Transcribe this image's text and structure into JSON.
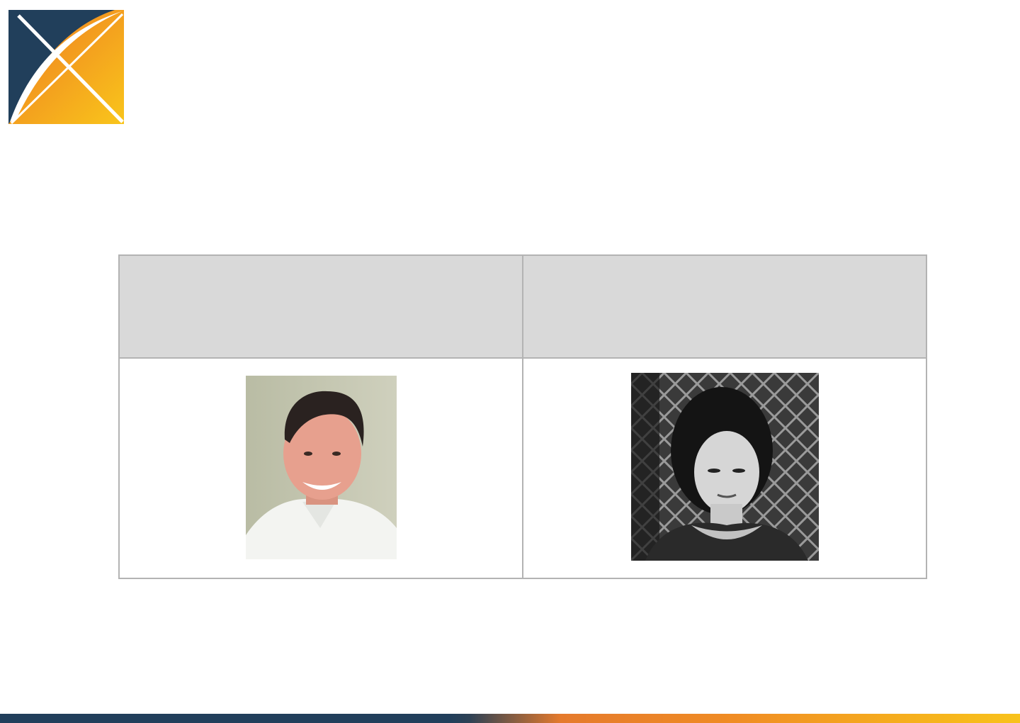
{
  "brand": {
    "logo_icon": "x-logo-icon",
    "colors": {
      "navy": "#213f5b",
      "orange": "#ef7f22",
      "yellow": "#f9c51b",
      "table_header": "#d9d9d9",
      "table_border": "#b3b3b3"
    }
  },
  "table": {
    "headers": [
      "",
      ""
    ],
    "photos": [
      {
        "icon": "person-photo-color"
      },
      {
        "icon": "person-photo-bw"
      }
    ]
  },
  "footer": {
    "bar": "gradient-navy-orange-yellow"
  }
}
